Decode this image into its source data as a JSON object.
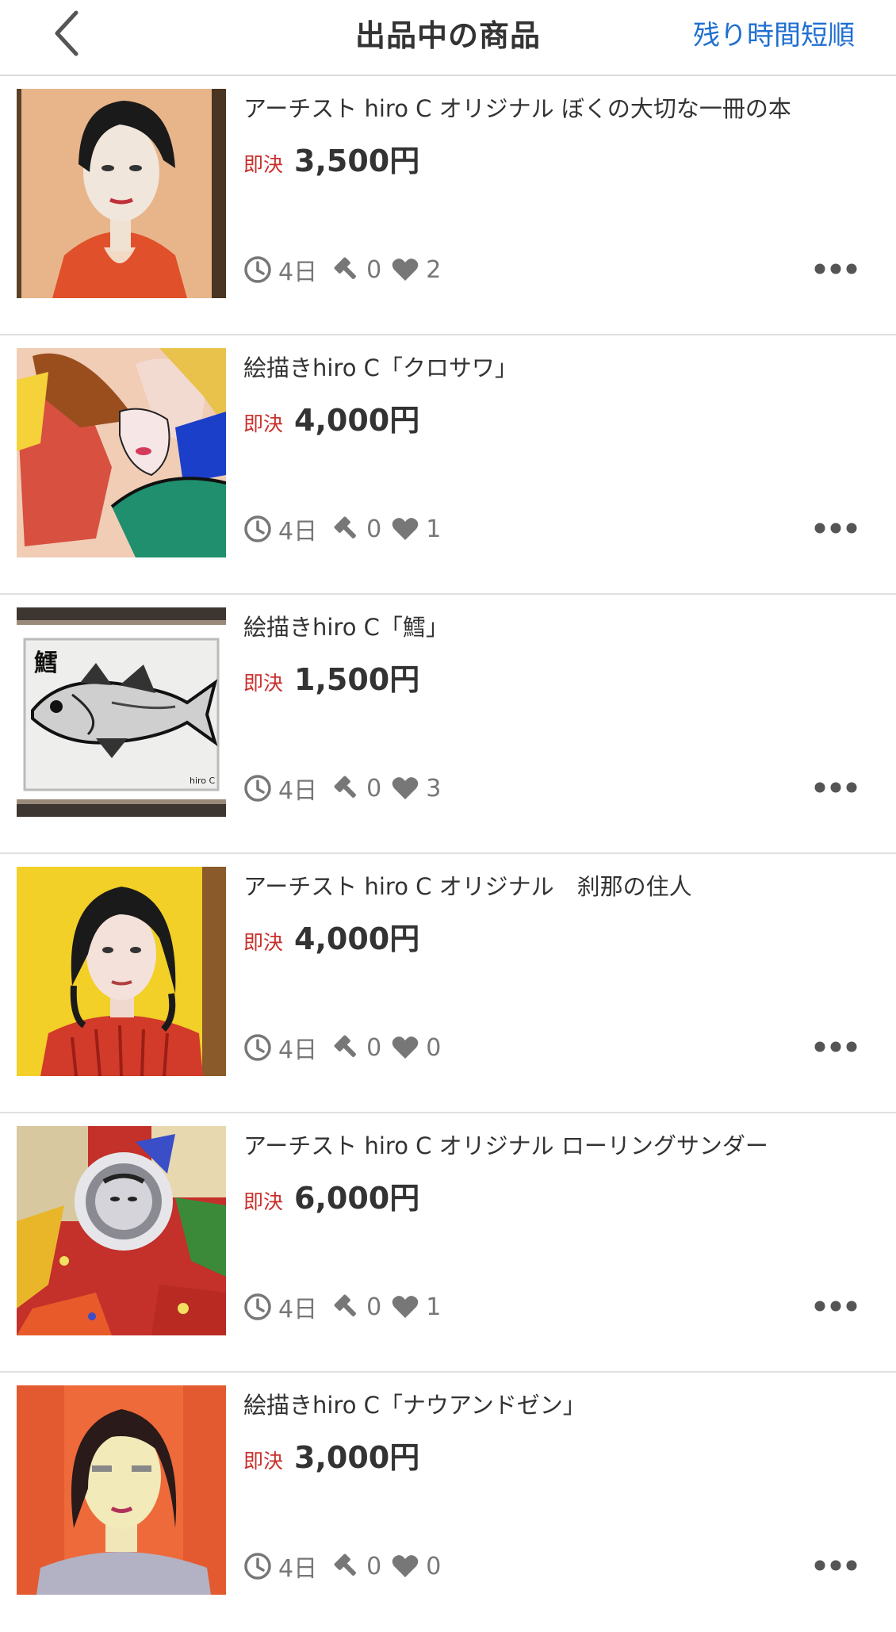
{
  "header": {
    "title": "出品中の商品",
    "sort_label": "残り時間短順"
  },
  "colors": {
    "accent_blue": "#1f6fd1",
    "price_label_red": "#c9302c",
    "meta_gray": "#777777"
  },
  "items": [
    {
      "title": "アーチスト hiro C オリジナル ぼくの大切な一冊の本",
      "price_label": "即決",
      "price": "3,500円",
      "time_left": "4日",
      "bids": "0",
      "watchers": "2",
      "thumbnail": "portrait-red-dress"
    },
    {
      "title": "絵描きhiro C「クロサワ」",
      "price_label": "即決",
      "price": "4,000円",
      "time_left": "4日",
      "bids": "0",
      "watchers": "1",
      "thumbnail": "abstract-faces"
    },
    {
      "title": "絵描きhiro C「鱈」",
      "price_label": "即決",
      "price": "1,500円",
      "time_left": "4日",
      "bids": "0",
      "watchers": "3",
      "thumbnail": "fish-ink-drawing"
    },
    {
      "title": "アーチスト hiro C オリジナル　刹那の住人",
      "price_label": "即決",
      "price": "4,000円",
      "time_left": "4日",
      "bids": "0",
      "watchers": "0",
      "thumbnail": "portrait-yellow-background"
    },
    {
      "title": "アーチスト hiro C オリジナル ローリングサンダー",
      "price_label": "即決",
      "price": "6,000円",
      "time_left": "4日",
      "bids": "0",
      "watchers": "1",
      "thumbnail": "abstract-colorful-face"
    },
    {
      "title": "絵描きhiro C「ナウアンドゼン」",
      "price_label": "即決",
      "price": "3,000円",
      "time_left": "4日",
      "bids": "0",
      "watchers": "0",
      "thumbnail": "portrait-orange-background"
    }
  ]
}
